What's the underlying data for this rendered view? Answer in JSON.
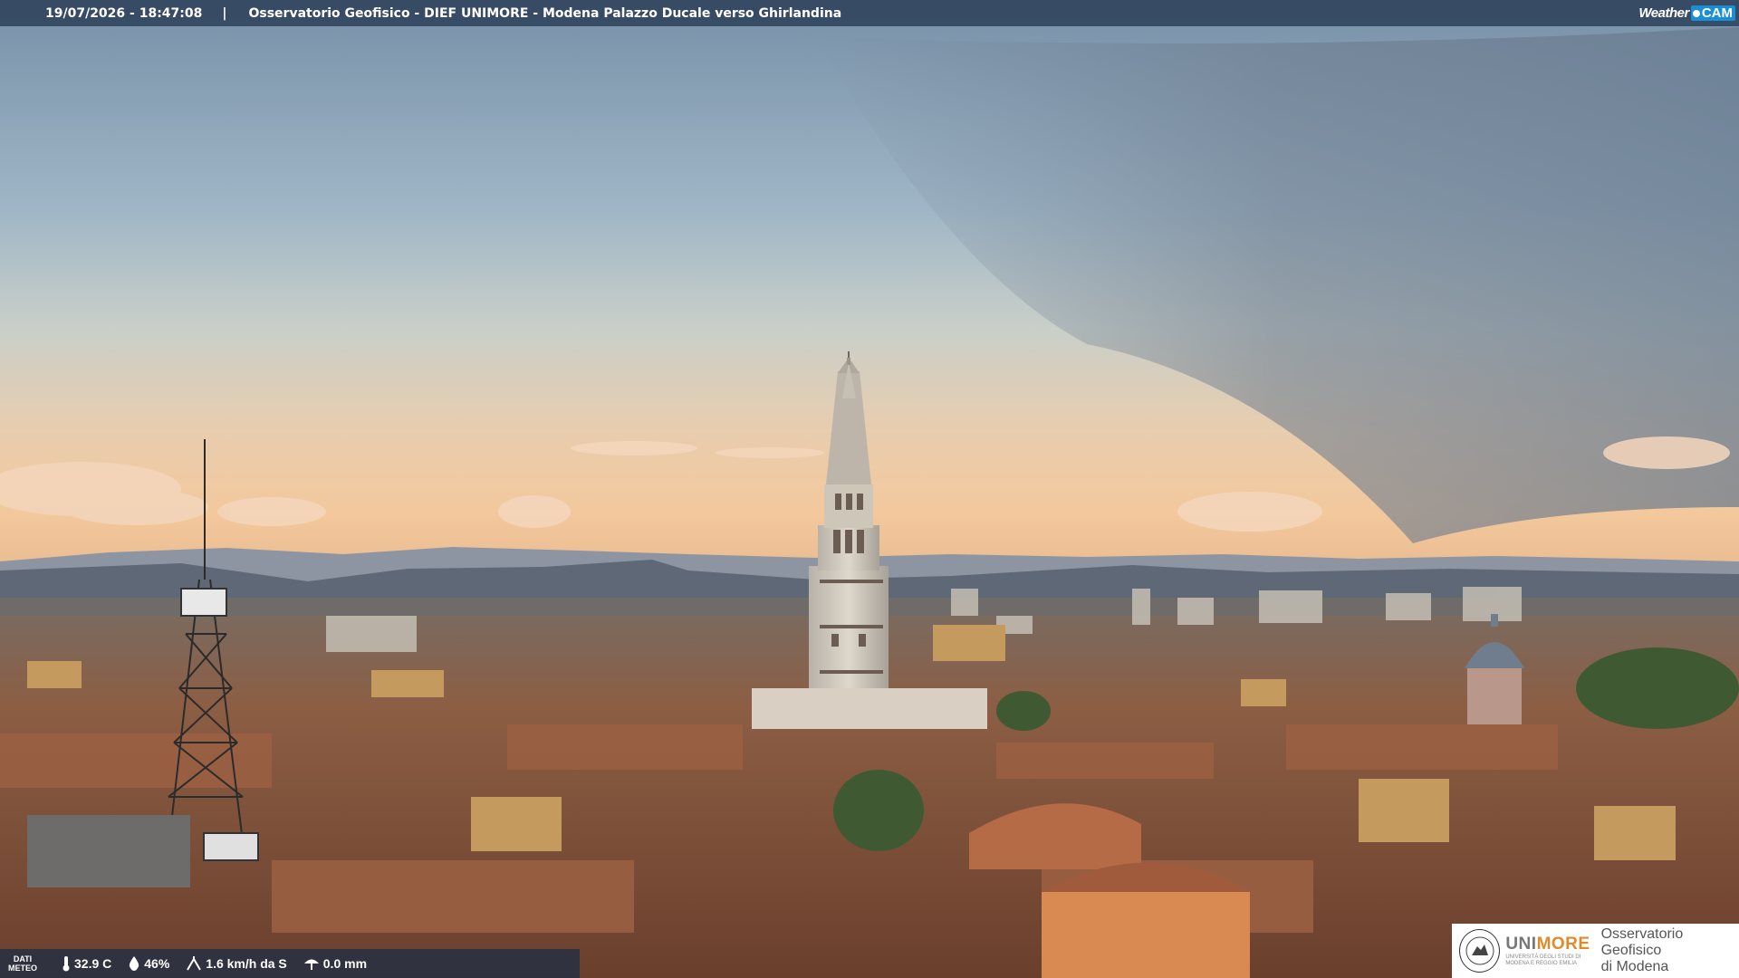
{
  "header": {
    "datetime": "19/07/2026 - 18:47:08",
    "separator": "|",
    "title": "Osservatorio Geofisico - DIEF UNIMORE - Modena Palazzo Ducale verso Ghirlandina",
    "logo_weather": "Weather",
    "logo_cam": "CAM"
  },
  "weather": {
    "label_line1": "DATI",
    "label_line2": "METEO",
    "temperature": "32.9 C",
    "humidity": "46%",
    "wind": "1.6 km/h da S",
    "rain": "0.0 mm"
  },
  "badge": {
    "uni_a": "UNI",
    "uni_b": "MORE",
    "uni_sub1": "UNIVERSITÀ DEGLI STUDI DI",
    "uni_sub2": "MODENA E REGGIO EMILIA",
    "obs_line1": "Osservatorio Geofisico",
    "obs_line2": "di Modena"
  },
  "colors": {
    "sky_top": "#7f97ad",
    "sky_horizon": "#f0c9a0",
    "roofs": "#8a5a40",
    "accent_cam": "#1b8fd6",
    "accent_more": "#e08a2a"
  }
}
